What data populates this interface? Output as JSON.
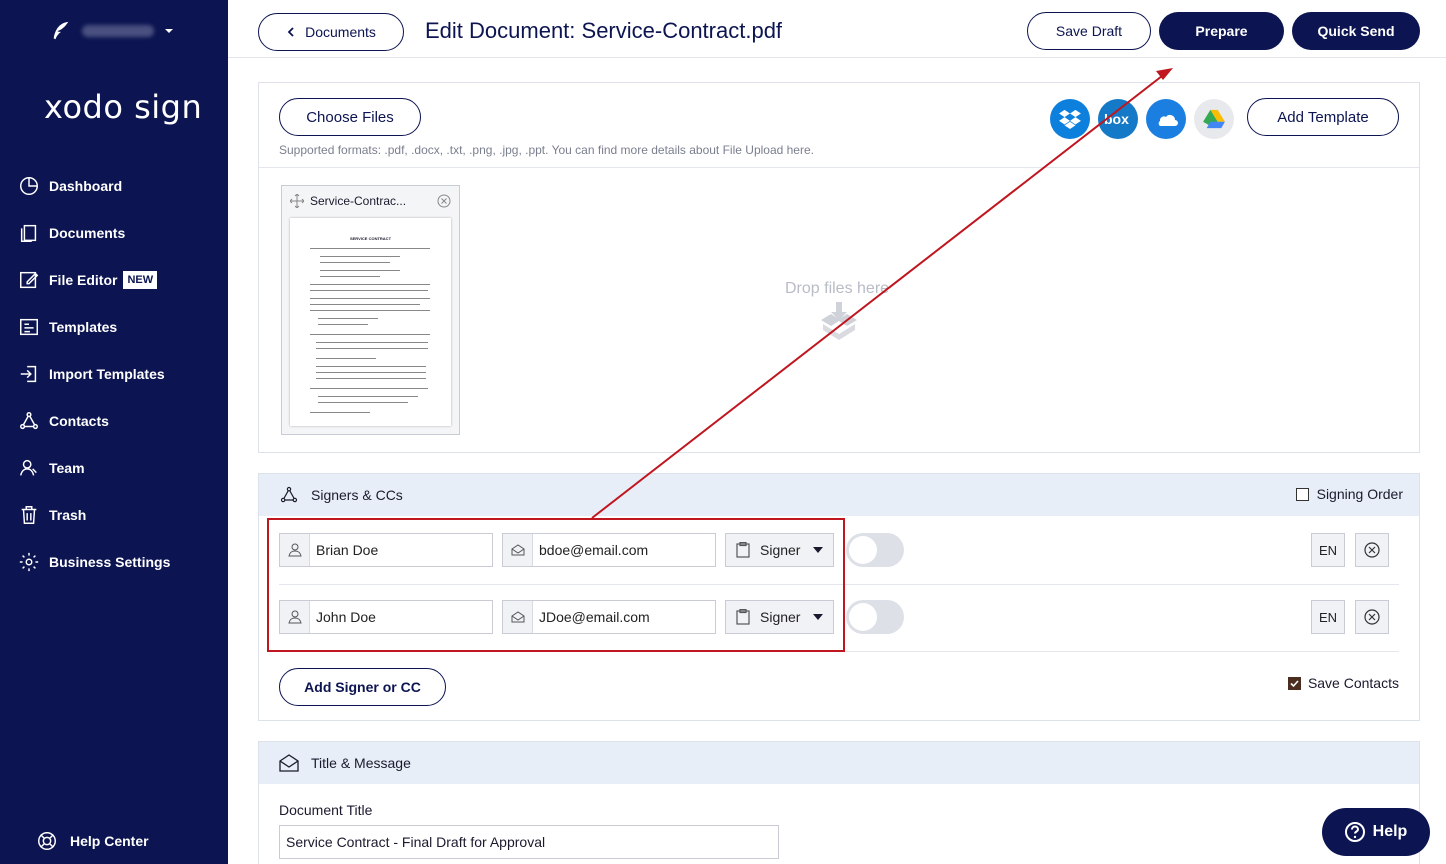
{
  "sidebar": {
    "logo": "xodo sign",
    "items": [
      {
        "label": "Dashboard",
        "icon": "dashboard-icon"
      },
      {
        "label": "Documents",
        "icon": "documents-icon"
      },
      {
        "label": "File Editor",
        "icon": "file-editor-icon",
        "badge": "NEW"
      },
      {
        "label": "Templates",
        "icon": "templates-icon"
      },
      {
        "label": "Import Templates",
        "icon": "import-icon"
      },
      {
        "label": "Contacts",
        "icon": "contacts-icon"
      },
      {
        "label": "Team",
        "icon": "team-icon"
      },
      {
        "label": "Trash",
        "icon": "trash-icon"
      },
      {
        "label": "Business Settings",
        "icon": "settings-icon"
      }
    ],
    "help_center": "Help Center"
  },
  "header": {
    "back_label": "Documents",
    "title": "Edit Document: Service-Contract.pdf",
    "save_draft": "Save Draft",
    "prepare": "Prepare",
    "quick_send": "Quick Send"
  },
  "upload": {
    "choose_files": "Choose Files",
    "formats": "Supported formats: .pdf, .docx, .txt, .png, .jpg, .ppt. You can find more details about File Upload here.",
    "add_template": "Add Template",
    "drop_text": "Drop files here",
    "file_name": "Service-Contrac...",
    "doc_heading": "SERVICE CONTRACT"
  },
  "signers": {
    "header": "Signers & CCs",
    "signing_order": "Signing Order",
    "rows": [
      {
        "name": "Brian Doe",
        "email": "bdoe@email.com",
        "role": "Signer",
        "lang": "EN"
      },
      {
        "name": "John Doe",
        "email": "JDoe@email.com",
        "role": "Signer",
        "lang": "EN"
      }
    ],
    "add_label": "Add Signer or CC",
    "save_contacts": "Save Contacts"
  },
  "message": {
    "header": "Title & Message",
    "doc_title_label": "Document Title",
    "doc_title_value": "Service Contract - Final Draft for Approval"
  },
  "help_label": "Help",
  "colors": {
    "navy": "#0c1451",
    "annotation": "#c0161f"
  }
}
